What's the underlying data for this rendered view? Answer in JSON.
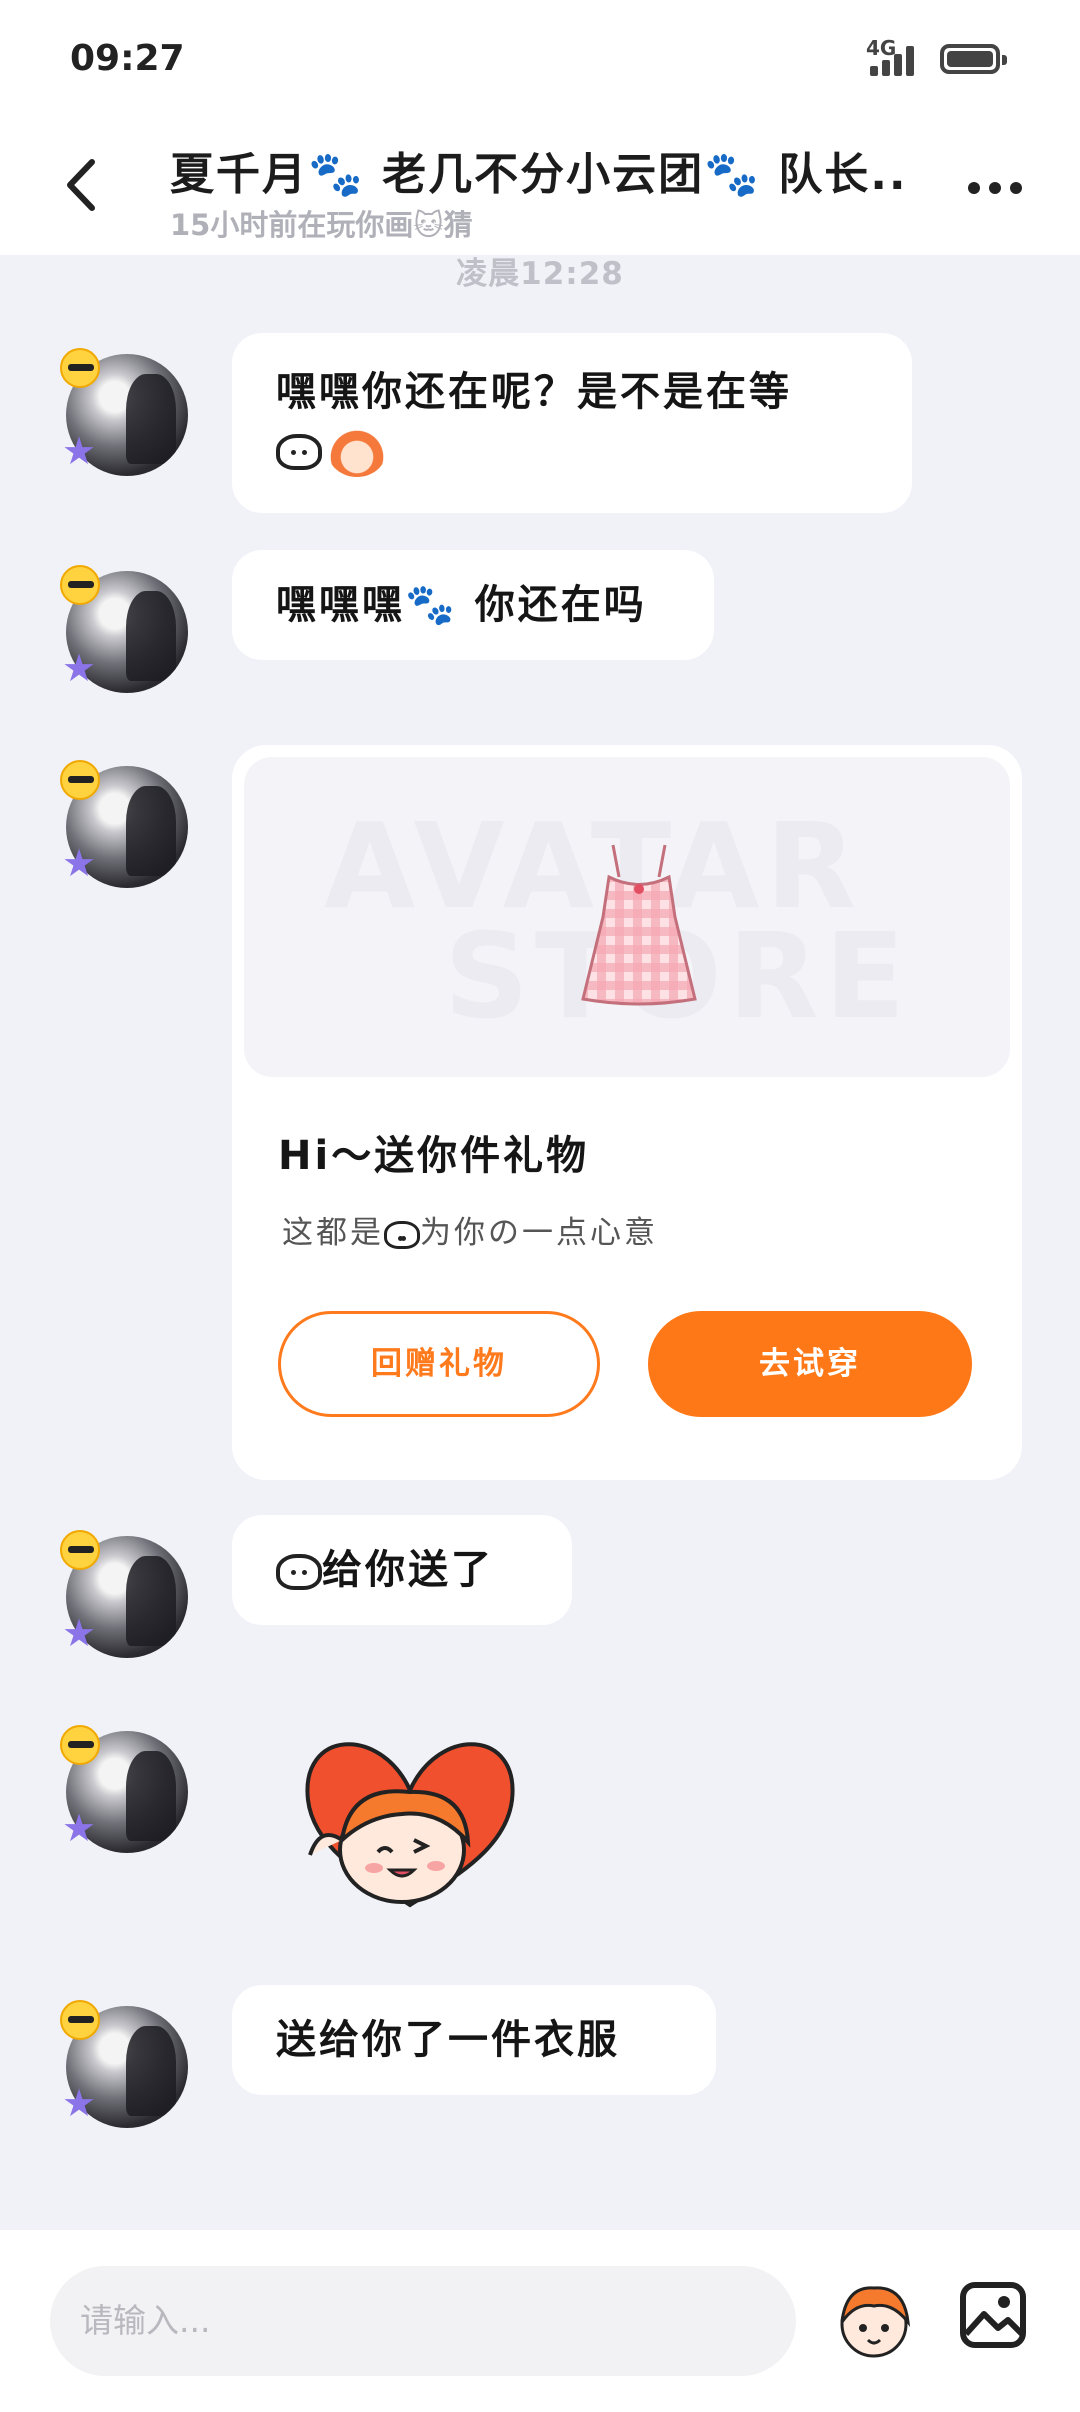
{
  "status_bar": {
    "time": "09:27",
    "network": "4G"
  },
  "header": {
    "title": "夏千月🐾 老几不分小云团🐾 队长...",
    "subtitle": "15小时前在玩你画🐱猜",
    "back_icon": "chevron-left-icon",
    "more_icon": "more-dots-icon"
  },
  "chat": {
    "timestamp": "凌晨12:28",
    "messages": [
      {
        "text": "嘿嘿你还在呢？是不是在等"
      },
      {
        "text": "嘿嘿嘿🐾 你还在吗"
      },
      {
        "text": "给你送了"
      },
      {
        "text": "送给你了一件衣服"
      }
    ],
    "gift_card": {
      "watermark_line1": "AVATAR",
      "watermark_line2": "STORE",
      "title": "Hi～送你件礼物",
      "description_a": "这都是",
      "description_b": "为你の一点心意",
      "return_button": "回赠礼物",
      "try_button": "去试穿"
    }
  },
  "input_bar": {
    "placeholder": "请输入...",
    "mascot_icon": "mascot-emoji-icon",
    "image_icon": "image-icon"
  },
  "colors": {
    "accent": "#ff7817",
    "background": "#f1f2f8"
  }
}
